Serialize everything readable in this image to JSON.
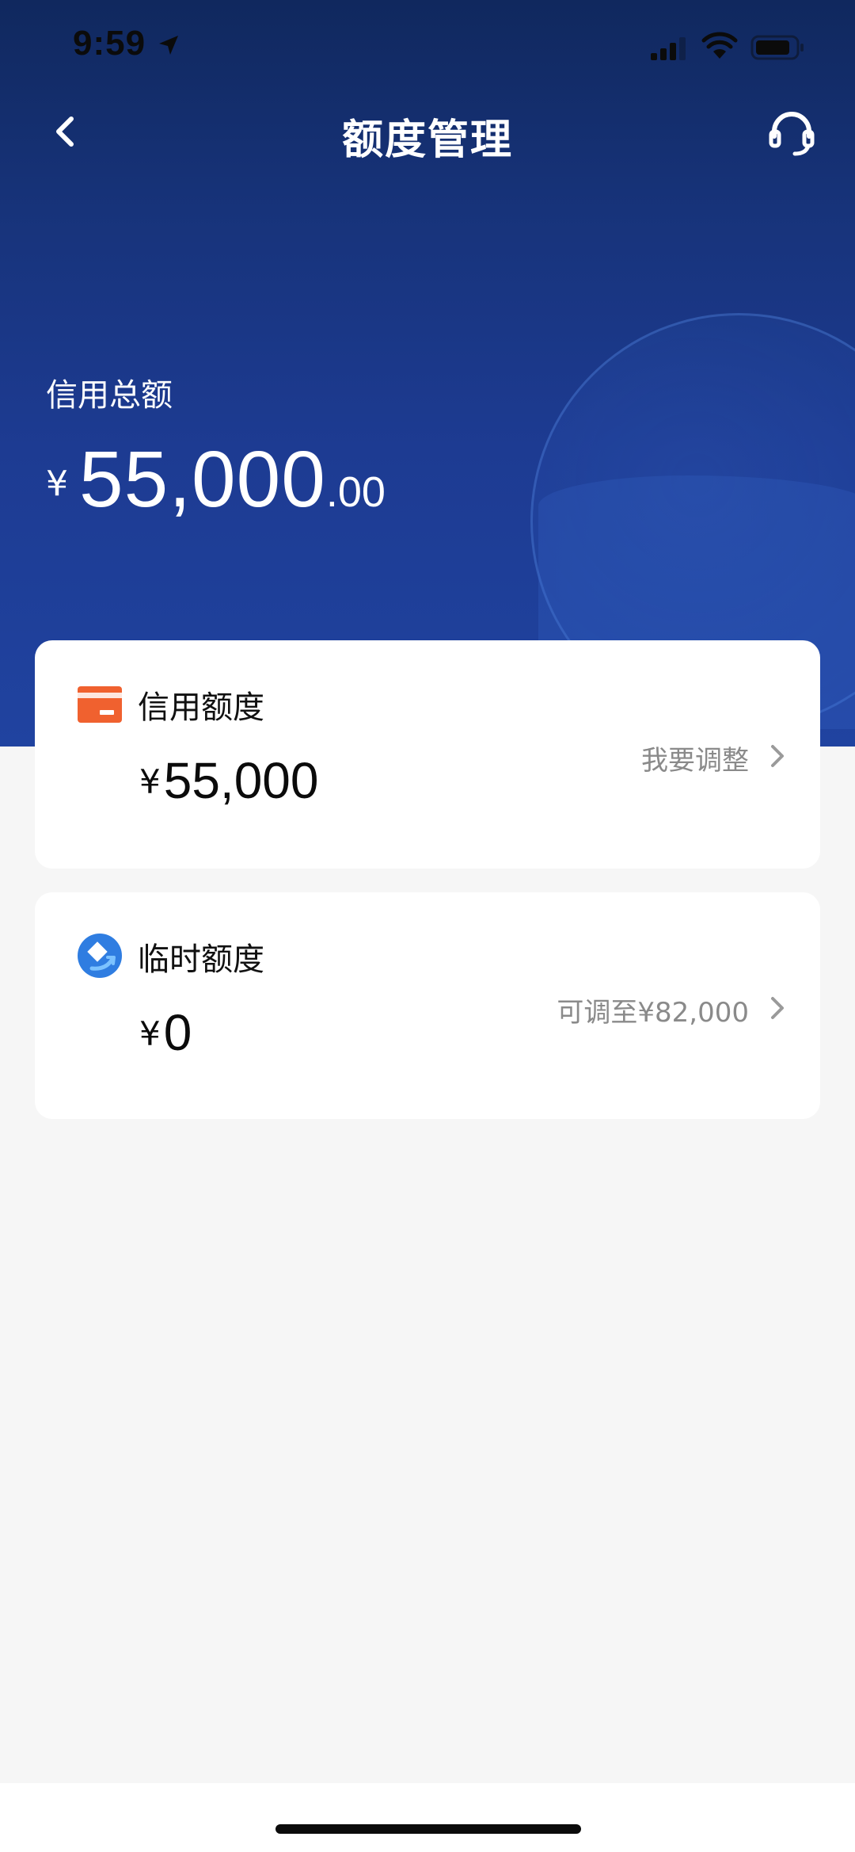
{
  "status_bar": {
    "time": "9:59"
  },
  "nav": {
    "title": "额度管理",
    "back_icon": "chevron-left-icon",
    "support_icon": "headset-icon"
  },
  "summary": {
    "label": "信用总额",
    "currency": "¥",
    "amount_integer": "55,000",
    "amount_decimal": ".00"
  },
  "cards": [
    {
      "icon": "card-icon",
      "title": "信用额度",
      "currency": "¥",
      "amount": "55,000",
      "action": "我要调整"
    },
    {
      "icon": "temporary-limit-icon",
      "title": "临时额度",
      "currency": "¥",
      "amount": "0",
      "action": "可调至¥82,000"
    }
  ],
  "colors": {
    "header_dark": "#10285e",
    "header_light": "#2043a0",
    "background": "#f6f6f6",
    "card": "#ffffff",
    "orange_accent": "#f0612f",
    "blue_accent": "#2f7de1",
    "secondary_text": "#8a8a8a"
  }
}
